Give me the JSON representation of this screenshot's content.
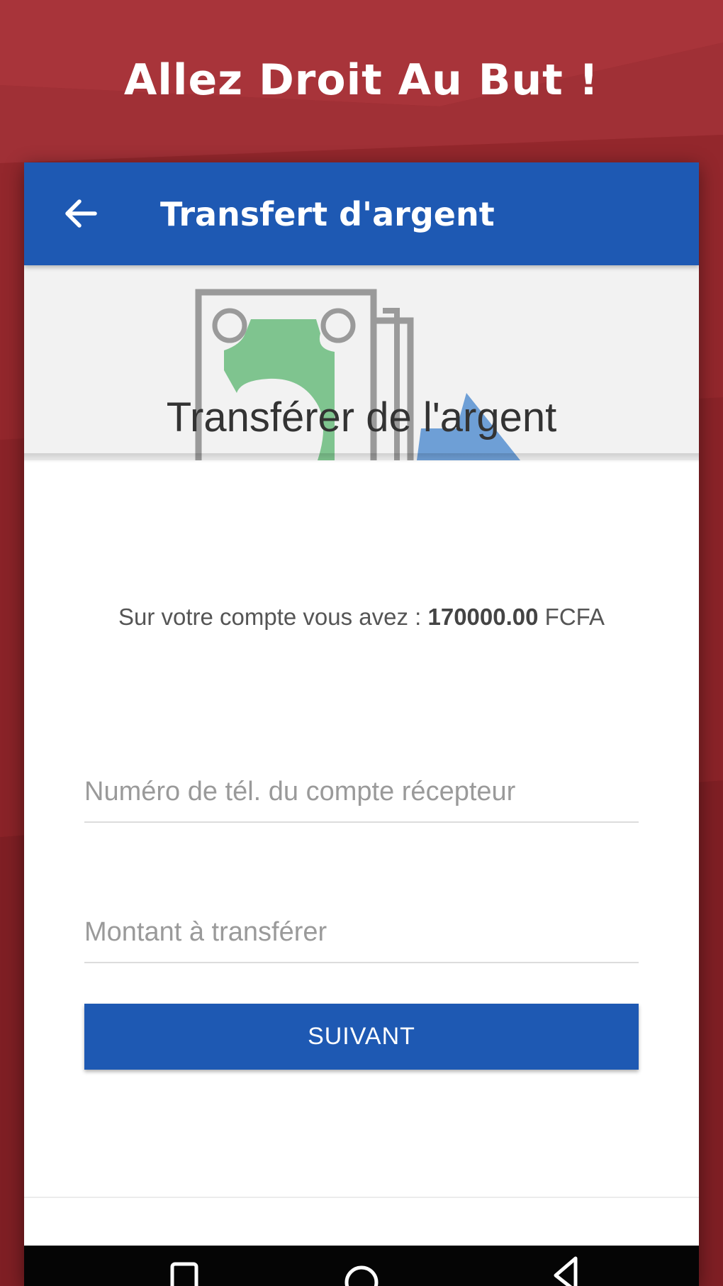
{
  "banner": {
    "tagline": "Allez Droit Au But !"
  },
  "appbar": {
    "title": "Transfert d'argent",
    "back_icon": "arrow-left-icon"
  },
  "hero": {
    "illustration": "money-transfer-illustration"
  },
  "form": {
    "title": "Transférer de l'argent",
    "balance_prefix": "Sur votre compte vous avez : ",
    "balance_amount": "170000.00",
    "balance_currency": " FCFA",
    "phone_placeholder": "Numéro de tél. du compte récepteur",
    "phone_value": "",
    "amount_placeholder": "Montant à transférer",
    "amount_value": "",
    "submit_label": "SUIVANT"
  },
  "navigation_bar": {
    "icons": [
      "square-recents-icon",
      "circle-home-icon",
      "triangle-back-icon"
    ]
  },
  "colors": {
    "background": "#9c2b30",
    "primary": "#1e59b3",
    "hero_background": "#f2f2f2",
    "money_green": "#7fc48f",
    "arrow_blue": "#6e9fd6",
    "outline_gray": "#9a9a9a"
  }
}
